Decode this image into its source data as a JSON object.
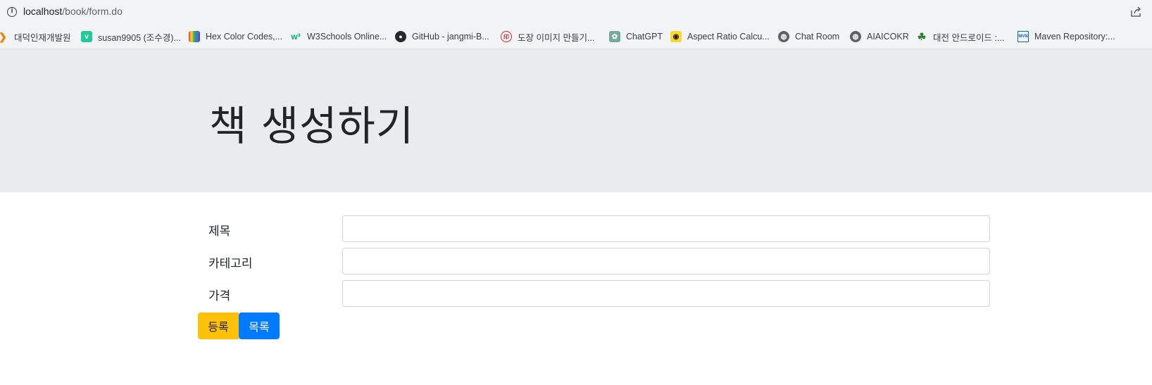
{
  "browser": {
    "url_host": "localhost",
    "url_path": "/book/form.do"
  },
  "bookmarks": [
    {
      "label": "대덕인재개발원",
      "icon": "flame-icon",
      "color": "#f57c00"
    },
    {
      "label": "susan9905 (조수경)...",
      "icon": "velog-icon",
      "color": "#20c997"
    },
    {
      "label": "Hex Color Codes,...",
      "icon": "book-rainbow-icon",
      "color": "#e53935"
    },
    {
      "label": "W3Schools Online...",
      "icon": "w3schools-icon",
      "color": "#04aa6d"
    },
    {
      "label": "GitHub - jangmi-B...",
      "icon": "github-icon",
      "color": "#24292e"
    },
    {
      "label": "도장 이미지 만들기...",
      "icon": "stamp-icon",
      "color": "#d32f2f"
    },
    {
      "label": "ChatGPT",
      "icon": "chatgpt-icon",
      "color": "#74aa9c"
    },
    {
      "label": "Aspect Ratio Calcu...",
      "icon": "aspect-ratio-icon",
      "color": "#fdd835"
    },
    {
      "label": "Chat Room",
      "icon": "globe-icon",
      "color": "#5f6368"
    },
    {
      "label": "AIAICOKR",
      "icon": "globe-icon",
      "color": "#5f6368"
    },
    {
      "label": "대전 안드로이드 :...",
      "icon": "leaf-icon",
      "color": "#2e7d32"
    },
    {
      "label": "Maven Repository:...",
      "icon": "maven-icon",
      "color": "#1565c0"
    }
  ],
  "page": {
    "title": "책 생성하기"
  },
  "form": {
    "fields": [
      {
        "label": "제목",
        "value": "",
        "placeholder": ""
      },
      {
        "label": "카테고리",
        "value": "",
        "placeholder": ""
      },
      {
        "label": "가격",
        "value": "",
        "placeholder": ""
      }
    ],
    "submit_label": "등록",
    "list_label": "목록"
  },
  "colors": {
    "jumbotron_bg": "#e9ecef",
    "warning": "#ffc107",
    "primary": "#007bff"
  }
}
